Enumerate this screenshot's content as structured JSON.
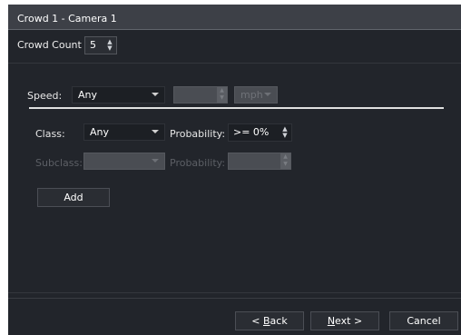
{
  "window": {
    "title": "Crowd 1 - Camera 1"
  },
  "crowd_count": {
    "label": "Crowd Count",
    "value": "5"
  },
  "speed": {
    "label": "Speed:",
    "value": "Any",
    "number": "",
    "unit": "mph"
  },
  "class_row": {
    "label": "Class:",
    "value": "Any",
    "probability_label": "Probability:",
    "probability_value": ">= 0%"
  },
  "subclass_row": {
    "label": "Subclass:",
    "value": "",
    "probability_label": "Probability:",
    "probability_value": ""
  },
  "buttons": {
    "add": "Add",
    "back_prefix": "< ",
    "back_key": "B",
    "back_rest": "ack",
    "next_key": "N",
    "next_rest": "ext >",
    "cancel": "Cancel"
  }
}
